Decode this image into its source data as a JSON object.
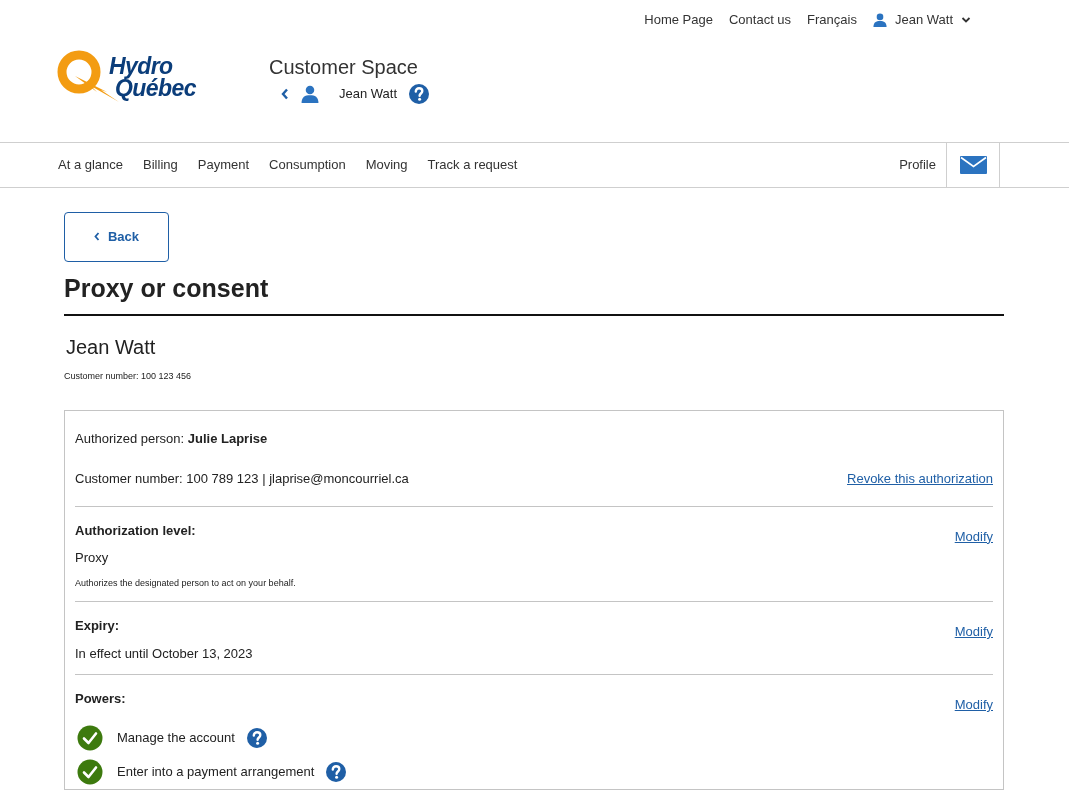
{
  "top_links": [
    "Home Page",
    "Contact us",
    "Français"
  ],
  "user_menu": {
    "name": "Jean Watt"
  },
  "logo": {
    "line1": "Hydro",
    "line2": "Québec"
  },
  "space": {
    "title": "Customer Space",
    "account_name": "Jean Watt"
  },
  "nav": {
    "items": [
      "At a glance",
      "Billing",
      "Payment",
      "Consumption",
      "Moving",
      "Track a request"
    ],
    "profile": "Profile"
  },
  "back_button": "Back",
  "page_title": "Proxy or consent",
  "customer": {
    "name": "Jean Watt",
    "number": "Customer number: 100 123 456"
  },
  "authorization": {
    "person_label": "Authorized person: ",
    "person_name": "Julie Laprise",
    "details": "Customer number: 100 789 123 | jlaprise@moncourriel.ca",
    "revoke": "Revoke this authorization"
  },
  "sections": [
    {
      "kind": "text",
      "label": "Authorization level:",
      "link": "Modify",
      "value": "Proxy",
      "note": "Authorizes the designated person to act on your behalf."
    },
    {
      "kind": "text",
      "label": "Expiry:",
      "link": "Modify",
      "value": "In effect until October 13, 2023"
    },
    {
      "kind": "powers",
      "label": "Powers:",
      "link": "Modify",
      "powers": [
        {
          "label": "Manage the account",
          "checked": true
        },
        {
          "label": "Enter into a payment arrangement",
          "checked": true
        }
      ]
    }
  ]
}
